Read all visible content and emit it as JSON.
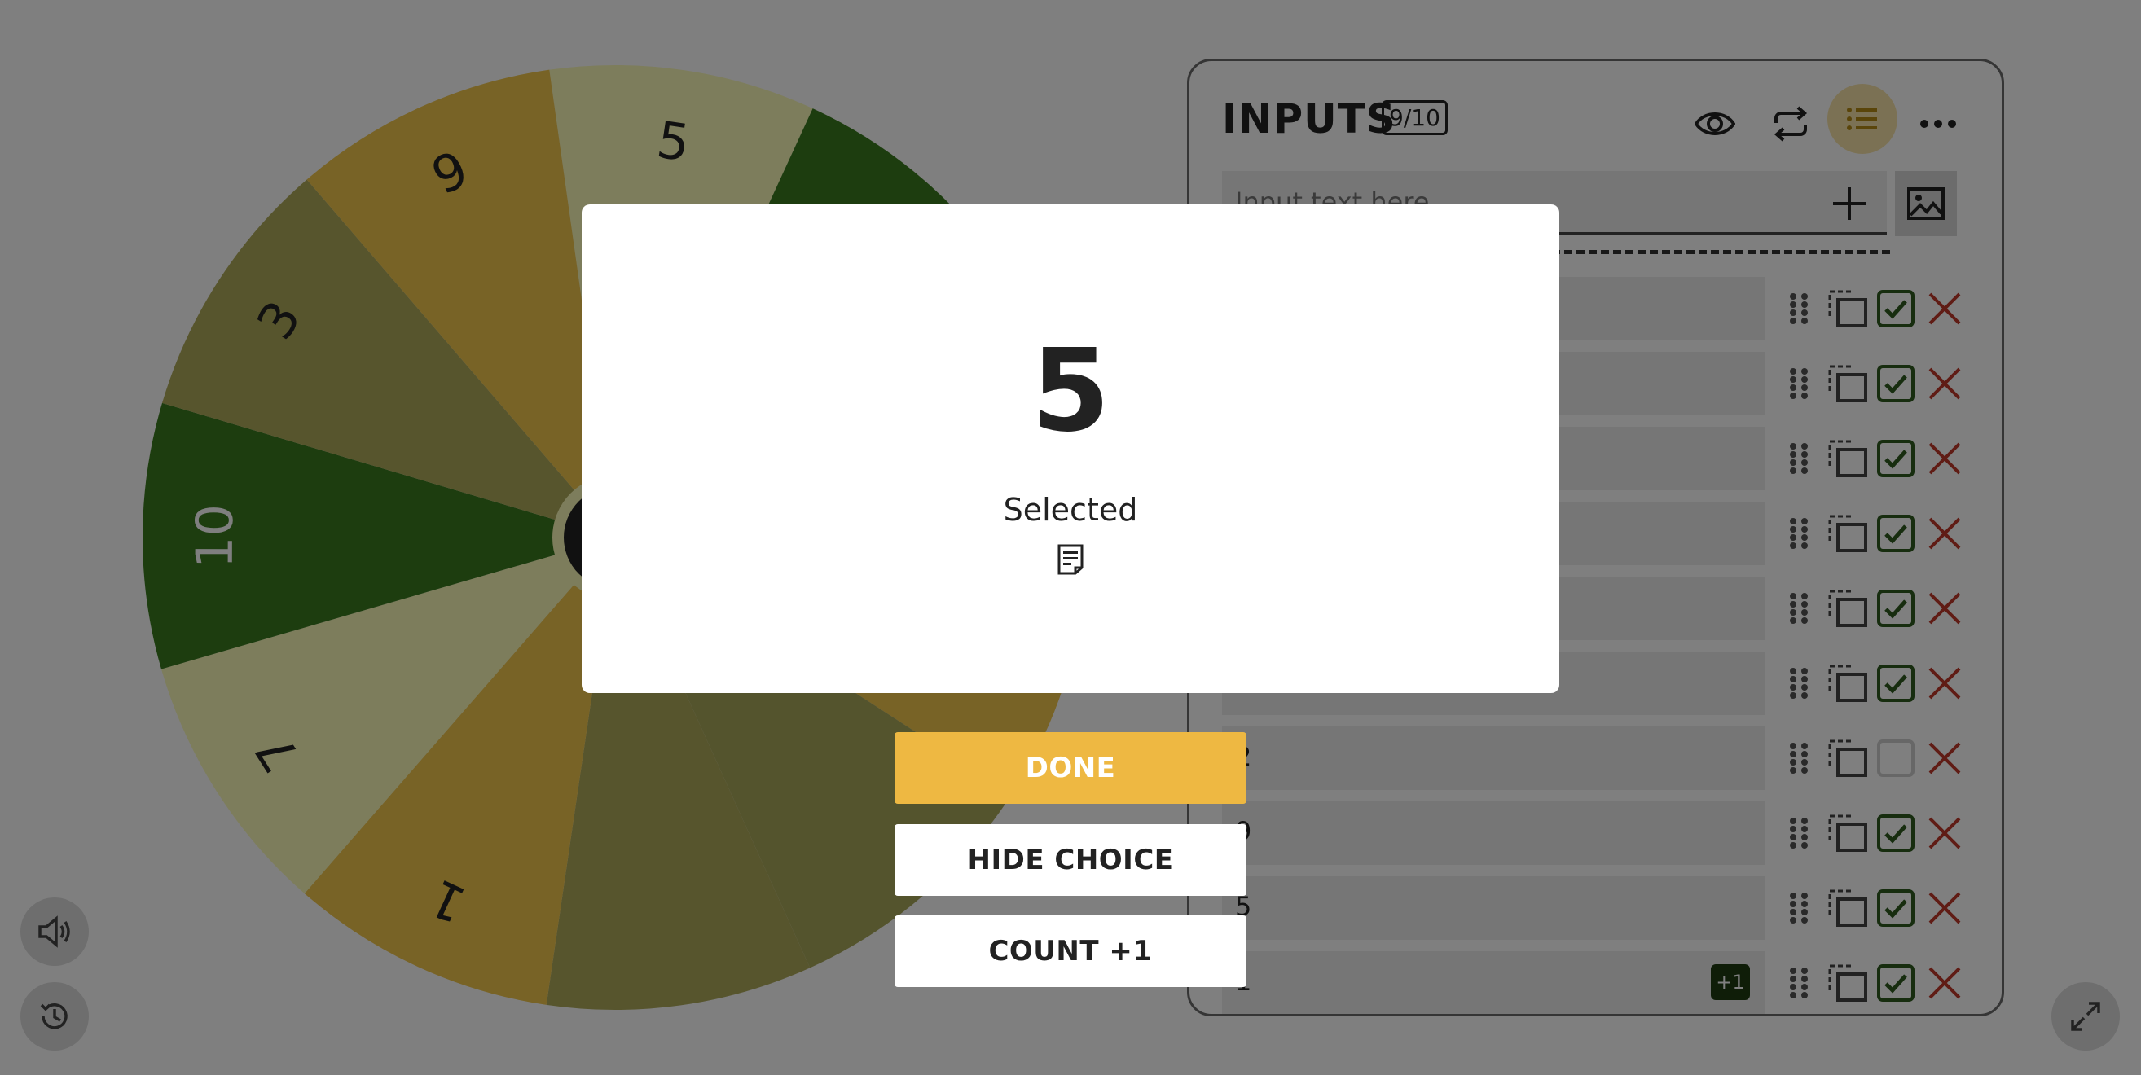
{
  "wheel": {
    "segments": [
      {
        "label": "5",
        "color": "#fbfbb8"
      },
      {
        "label": "",
        "color": "#3a7a1e"
      },
      {
        "label": "",
        "color": "#3a7a1e"
      },
      {
        "label": "",
        "color": "#f0c64c"
      },
      {
        "label": "",
        "color": "#a8a85a"
      },
      {
        "label": "",
        "color": "#aeaa5a"
      },
      {
        "label": "1",
        "color": "#f0c64c"
      },
      {
        "label": "7",
        "color": "#fbfbb8"
      },
      {
        "label": "10",
        "color": "#3a7a1e"
      },
      {
        "label": "3",
        "color": "#aeaa5a"
      },
      {
        "label": "9",
        "color": "#f0c64c"
      }
    ],
    "hub_color": "#222222",
    "label_color_light": "#ffffff",
    "label_color_dark": "#222222"
  },
  "panel": {
    "title": "INPUTS",
    "count": "9/10",
    "input_placeholder": "Input text here",
    "active_color": "#f7e3a8",
    "rows": [
      {
        "text": "",
        "checked": true,
        "badge": ""
      },
      {
        "text": "",
        "checked": true,
        "badge": ""
      },
      {
        "text": "",
        "checked": true,
        "badge": ""
      },
      {
        "text": "",
        "checked": true,
        "badge": ""
      },
      {
        "text": "",
        "checked": true,
        "badge": ""
      },
      {
        "text": "",
        "checked": true,
        "badge": ""
      },
      {
        "text": "2",
        "checked": false,
        "badge": ""
      },
      {
        "text": "9",
        "checked": true,
        "badge": ""
      },
      {
        "text": "5",
        "checked": true,
        "badge": ""
      },
      {
        "text": "1",
        "checked": true,
        "badge": "+1"
      }
    ]
  },
  "modal": {
    "result": "5",
    "label": "Selected",
    "done_label": "DONE",
    "hide_label": "HIDE CHOICE",
    "count_label": "COUNT +1",
    "done_color": "#eeb842"
  }
}
